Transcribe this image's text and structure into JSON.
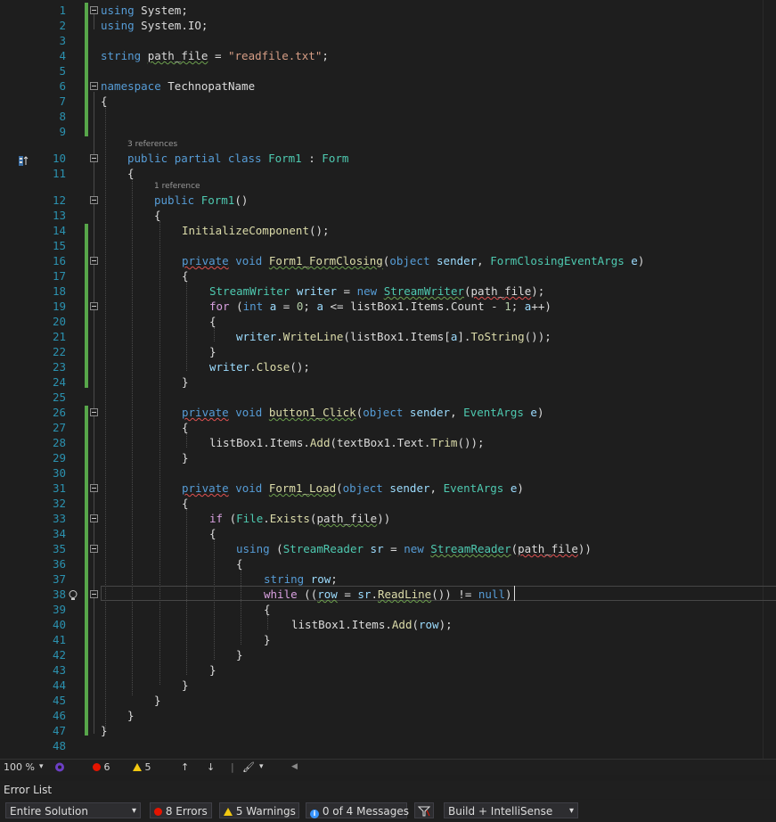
{
  "editor": {
    "line_numbers": [
      "1",
      "2",
      "3",
      "4",
      "5",
      "6",
      "7",
      "8",
      "9",
      "10",
      "11",
      "12",
      "13",
      "14",
      "15",
      "16",
      "17",
      "18",
      "19",
      "20",
      "21",
      "22",
      "23",
      "24",
      "25",
      "26",
      "27",
      "28",
      "29",
      "30",
      "31",
      "32",
      "33",
      "34",
      "35",
      "36",
      "37",
      "38",
      "39",
      "40",
      "41",
      "42",
      "43",
      "44",
      "45",
      "46",
      "47",
      "48"
    ],
    "code_lens": {
      "class_refs": "3 references",
      "ctor_refs": "1 reference"
    },
    "lines": {
      "l1": [
        "using",
        " ",
        "System",
        ";"
      ],
      "l2": [
        "using",
        " ",
        "System.IO",
        ";"
      ],
      "l4": [
        "string",
        " ",
        "path_file",
        " = ",
        "\"readfile.txt\"",
        ";"
      ],
      "l6": [
        "namespace",
        " ",
        "TechnopatName"
      ],
      "l7": "{",
      "l10": [
        "public",
        " ",
        "partial",
        " ",
        "class",
        " ",
        "Form1",
        " : ",
        "Form"
      ],
      "l11": "{",
      "l12": [
        "public",
        " ",
        "Form1",
        "()"
      ],
      "l13": "{",
      "l14": [
        "InitializeComponent",
        "();"
      ],
      "l16": [
        "private",
        " ",
        "void",
        " ",
        "Form1_FormClosing",
        "(",
        "object",
        " ",
        "sender",
        ", ",
        "FormClosingEventArgs",
        " ",
        "e",
        ")"
      ],
      "l17": "{",
      "l18": [
        "StreamWriter",
        " ",
        "writer",
        " = ",
        "new",
        " ",
        "StreamWriter",
        "(",
        "path_file",
        ");"
      ],
      "l19": [
        "for",
        " (",
        "int",
        " ",
        "a",
        " = ",
        "0",
        "; ",
        "a",
        " <= listBox1.Items.Count - ",
        "1",
        "; ",
        "a",
        "++)"
      ],
      "l20": "{",
      "l21": [
        "writer",
        ".",
        "WriteLine",
        "(listBox1.Items[",
        "a",
        "].",
        "ToString",
        "());"
      ],
      "l22": "}",
      "l23": [
        "writer",
        ".",
        "Close",
        "();"
      ],
      "l24": "}",
      "l26": [
        "private",
        " ",
        "void",
        " ",
        "button1_Click",
        "(",
        "object",
        " ",
        "sender",
        ", ",
        "EventArgs",
        " ",
        "e",
        ")"
      ],
      "l27": "{",
      "l28": [
        "listBox1.Items.",
        "Add",
        "(textBox1.Text.",
        "Trim",
        "());"
      ],
      "l29": "}",
      "l31": [
        "private",
        " ",
        "void",
        " ",
        "Form1_Load",
        "(",
        "object",
        " ",
        "sender",
        ", ",
        "EventArgs",
        " ",
        "e",
        ")"
      ],
      "l32": "{",
      "l33": [
        "if",
        " (",
        "File",
        ".",
        "Exists",
        "(",
        "path_file",
        "))"
      ],
      "l34": "{",
      "l35": [
        "using",
        " (",
        "StreamReader",
        " ",
        "sr",
        " = ",
        "new",
        " ",
        "StreamReader",
        "(",
        "path_file",
        "))"
      ],
      "l36": "{",
      "l37": [
        "string",
        " ",
        "row",
        ";"
      ],
      "l38": [
        "while",
        " ((",
        "row",
        " = ",
        "sr",
        ".",
        "ReadLine",
        "()) != ",
        "null",
        ")"
      ],
      "l39": "{",
      "l40": [
        "listBox1.Items.",
        "Add",
        "(",
        "row",
        ");"
      ],
      "l41": "}",
      "l42": "}",
      "l43": "}",
      "l44": "}",
      "l45": "}",
      "l46": "}",
      "l47": "}"
    }
  },
  "status": {
    "zoom": "100 %",
    "errors": "6",
    "warnings": "5"
  },
  "error_list": {
    "title": "Error List",
    "scope": "Entire Solution",
    "errors_btn": "8 Errors",
    "warnings_btn": "5 Warnings",
    "messages_btn": "0 of 4 Messages",
    "build_filter": "Build + IntelliSense"
  },
  "colors": {
    "keyword": "#569cd6",
    "control": "#d8a0df",
    "type": "#4ec9b0",
    "method": "#dcdcaa",
    "string": "#d69d85",
    "variable": "#9cdcfe",
    "number": "#b5cea8",
    "linenumber": "#2b91af"
  }
}
